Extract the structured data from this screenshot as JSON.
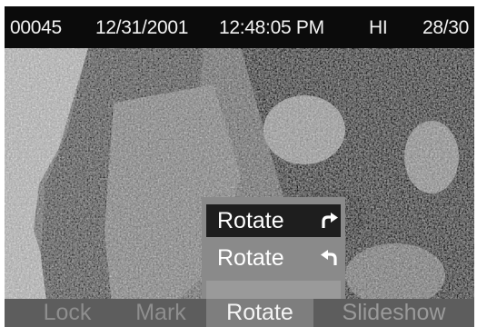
{
  "status_bar": {
    "file_number": "00045",
    "date": "12/31/2001",
    "time": "12:48:05 PM",
    "quality": "HI",
    "image_count": "28/30"
  },
  "rotate_menu": {
    "items": [
      {
        "label": "Rotate",
        "icon": "rotate-clockwise-icon",
        "selected": true
      },
      {
        "label": "Rotate",
        "icon": "rotate-counterclockwise-icon",
        "selected": false
      }
    ]
  },
  "softkeys": [
    {
      "label": "Lock",
      "active": false
    },
    {
      "label": "Mark",
      "active": false
    },
    {
      "label": "Rotate",
      "active": true
    },
    {
      "label": "Slideshow",
      "active": false
    }
  ],
  "colors": {
    "status_bar_bg": "#0b0b0b",
    "menu_bg": "#8a8a8a",
    "menu_selected_bg": "#1e1e1e",
    "softkey_bar_bg": "#5d5d5d",
    "softkey_active_bg": "#7e7e7e"
  }
}
